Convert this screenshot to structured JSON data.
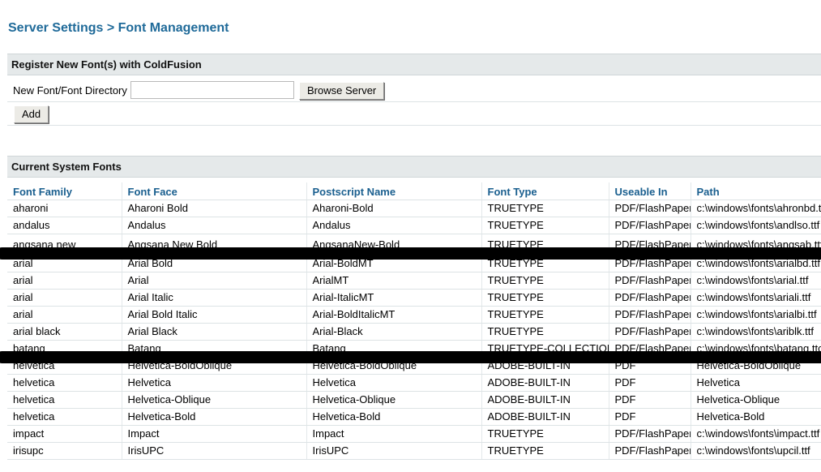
{
  "page_title": "Server Settings > Font Management",
  "register": {
    "heading": "Register New Font(s) with ColdFusion",
    "field_label": "New Font/Font Directory",
    "field_value": "",
    "browse_label": "Browse Server",
    "add_label": "Add"
  },
  "current": {
    "heading": "Current System Fonts",
    "columns": [
      "Font Family",
      "Font Face",
      "Postscript Name",
      "Font Type",
      "Useable In",
      "Path"
    ],
    "rows": [
      [
        "aharoni",
        "Aharoni Bold",
        "Aharoni-Bold",
        "TRUETYPE",
        "PDF/FlashPaper",
        "c:\\windows\\fonts\\ahronbd.ttf"
      ],
      [
        "andalus",
        "Andalus",
        "Andalus",
        "TRUETYPE",
        "PDF/FlashPaper",
        "c:\\windows\\fonts\\andlso.ttf"
      ],
      [
        "angsana new",
        "Angsana New Bold",
        "AngsanaNew-Bold",
        "TRUETYPE",
        "PDF/FlashPaper",
        "c:\\windows\\fonts\\angsab.ttf"
      ],
      [
        "arial",
        "Arial Bold",
        "Arial-BoldMT",
        "TRUETYPE",
        "PDF/FlashPaper",
        "c:\\windows\\fonts\\arialbd.ttf"
      ],
      [
        "arial",
        "Arial",
        "ArialMT",
        "TRUETYPE",
        "PDF/FlashPaper",
        "c:\\windows\\fonts\\arial.ttf"
      ],
      [
        "arial",
        "Arial Italic",
        "Arial-ItalicMT",
        "TRUETYPE",
        "PDF/FlashPaper",
        "c:\\windows\\fonts\\ariali.ttf"
      ],
      [
        "arial",
        "Arial Bold Italic",
        "Arial-BoldItalicMT",
        "TRUETYPE",
        "PDF/FlashPaper",
        "c:\\windows\\fonts\\arialbi.ttf"
      ],
      [
        "arial black",
        "Arial Black",
        "Arial-Black",
        "TRUETYPE",
        "PDF/FlashPaper",
        "c:\\windows\\fonts\\ariblk.ttf"
      ],
      [
        "batang",
        "Batang",
        "Batang",
        "TRUETYPE-COLLECTION",
        "PDF/FlashPaper",
        "c:\\windows\\fonts\\batang.ttc"
      ],
      [
        "helvetica",
        "Helvetica-BoldOblique",
        "Helvetica-BoldOblique",
        "ADOBE-BUILT-IN",
        "PDF",
        "Helvetica-BoldOblique"
      ],
      [
        "helvetica",
        "Helvetica",
        "Helvetica",
        "ADOBE-BUILT-IN",
        "PDF",
        "Helvetica"
      ],
      [
        "helvetica",
        "Helvetica-Oblique",
        "Helvetica-Oblique",
        "ADOBE-BUILT-IN",
        "PDF",
        "Helvetica-Oblique"
      ],
      [
        "helvetica",
        "Helvetica-Bold",
        "Helvetica-Bold",
        "ADOBE-BUILT-IN",
        "PDF",
        "Helvetica-Bold"
      ],
      [
        "impact",
        "Impact",
        "Impact",
        "TRUETYPE",
        "PDF/FlashPaper",
        "c:\\windows\\fonts\\impact.ttf"
      ],
      [
        "irisupc",
        "IrisUPC",
        "IrisUPC",
        "TRUETYPE",
        "PDF/FlashPaper",
        "c:\\windows\\fonts\\upcil.ttf"
      ]
    ]
  }
}
